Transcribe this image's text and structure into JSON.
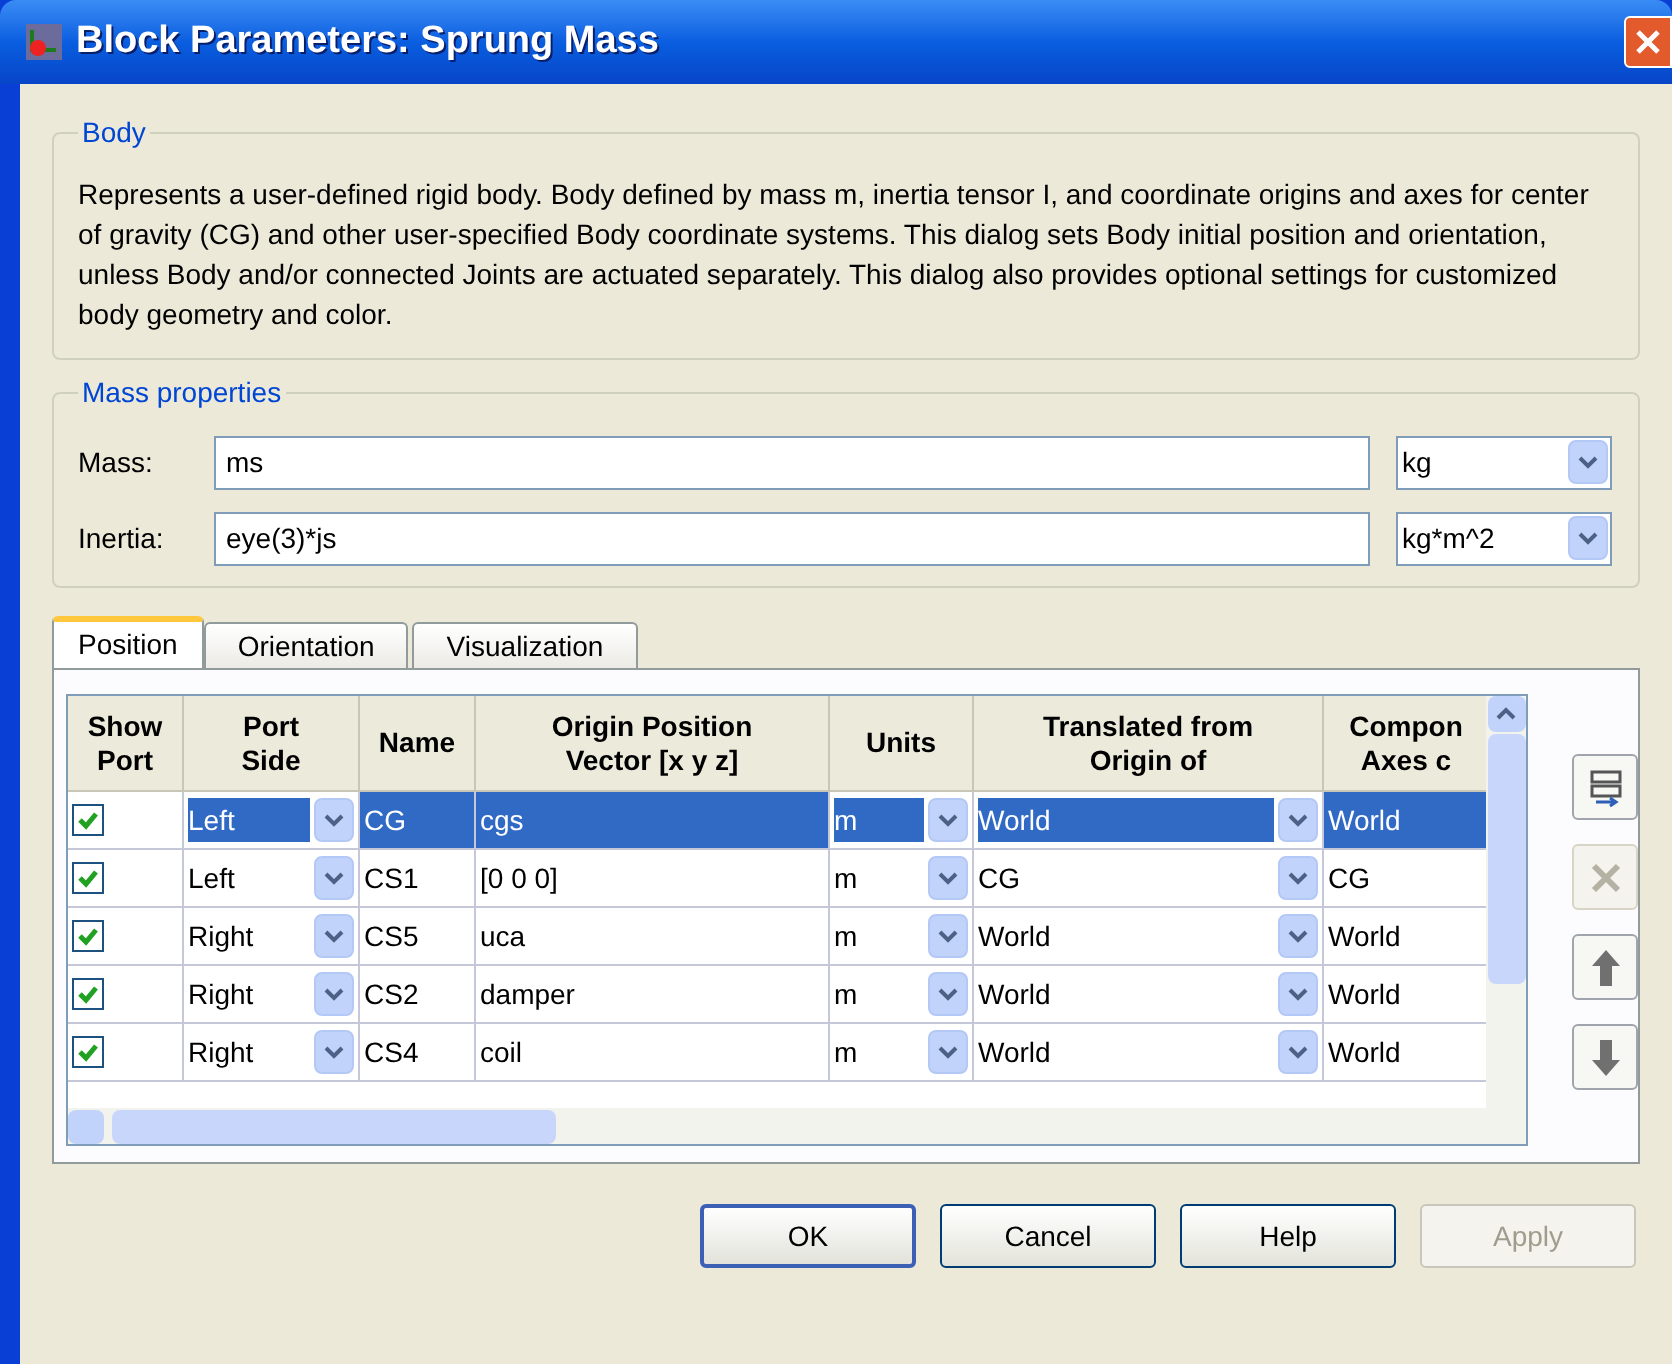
{
  "window": {
    "title": "Block Parameters: Sprung Mass"
  },
  "body_group": {
    "legend": "Body",
    "description": "Represents a user-defined rigid body. Body defined by mass m, inertia tensor I, and coordinate origins and axes for center of gravity (CG) and other user-specified Body coordinate systems. This dialog sets Body initial position and orientation, unless Body and/or connected Joints are actuated separately. This dialog also provides optional settings for customized body geometry and color."
  },
  "mass_group": {
    "legend": "Mass properties",
    "fields": [
      {
        "label": "Mass:",
        "value": "ms",
        "unit": "kg"
      },
      {
        "label": "Inertia:",
        "value": "eye(3)*js",
        "unit": "kg*m^2"
      }
    ]
  },
  "tabs": [
    {
      "label": "Position",
      "selected": true
    },
    {
      "label": "Orientation",
      "selected": false
    },
    {
      "label": "Visualization",
      "selected": false
    }
  ],
  "table": {
    "columns": [
      "Show\nPort",
      "Port\nSide",
      "Name",
      "Origin Position\nVector [x y z]",
      "Units",
      "Translated from\nOrigin of",
      "Compon\nAxes c"
    ],
    "rows": [
      {
        "show_port": true,
        "port_side": "Left",
        "name": "CG",
        "origin": "cgs",
        "units": "m",
        "translated_from": "World",
        "axes": "World",
        "selected": true
      },
      {
        "show_port": true,
        "port_side": "Left",
        "name": "CS1",
        "origin": "[0 0 0]",
        "units": "m",
        "translated_from": "CG",
        "axes": "CG",
        "selected": false
      },
      {
        "show_port": true,
        "port_side": "Right",
        "name": "CS5",
        "origin": "uca",
        "units": "m",
        "translated_from": "World",
        "axes": "World",
        "selected": false
      },
      {
        "show_port": true,
        "port_side": "Right",
        "name": "CS2",
        "origin": "damper",
        "units": "m",
        "translated_from": "World",
        "axes": "World",
        "selected": false
      },
      {
        "show_port": true,
        "port_side": "Right",
        "name": "CS4",
        "origin": "coil",
        "units": "m",
        "translated_from": "World",
        "axes": "World",
        "selected": false
      }
    ]
  },
  "side_buttons": [
    {
      "kind": "add",
      "disabled": false
    },
    {
      "kind": "delete",
      "disabled": true
    },
    {
      "kind": "up",
      "disabled": false
    },
    {
      "kind": "down",
      "disabled": false
    }
  ],
  "buttons": [
    {
      "label": "OK",
      "disabled": false,
      "default": true
    },
    {
      "label": "Cancel",
      "disabled": false,
      "default": false
    },
    {
      "label": "Help",
      "disabled": false,
      "default": false
    },
    {
      "label": "Apply",
      "disabled": true,
      "default": false
    }
  ]
}
